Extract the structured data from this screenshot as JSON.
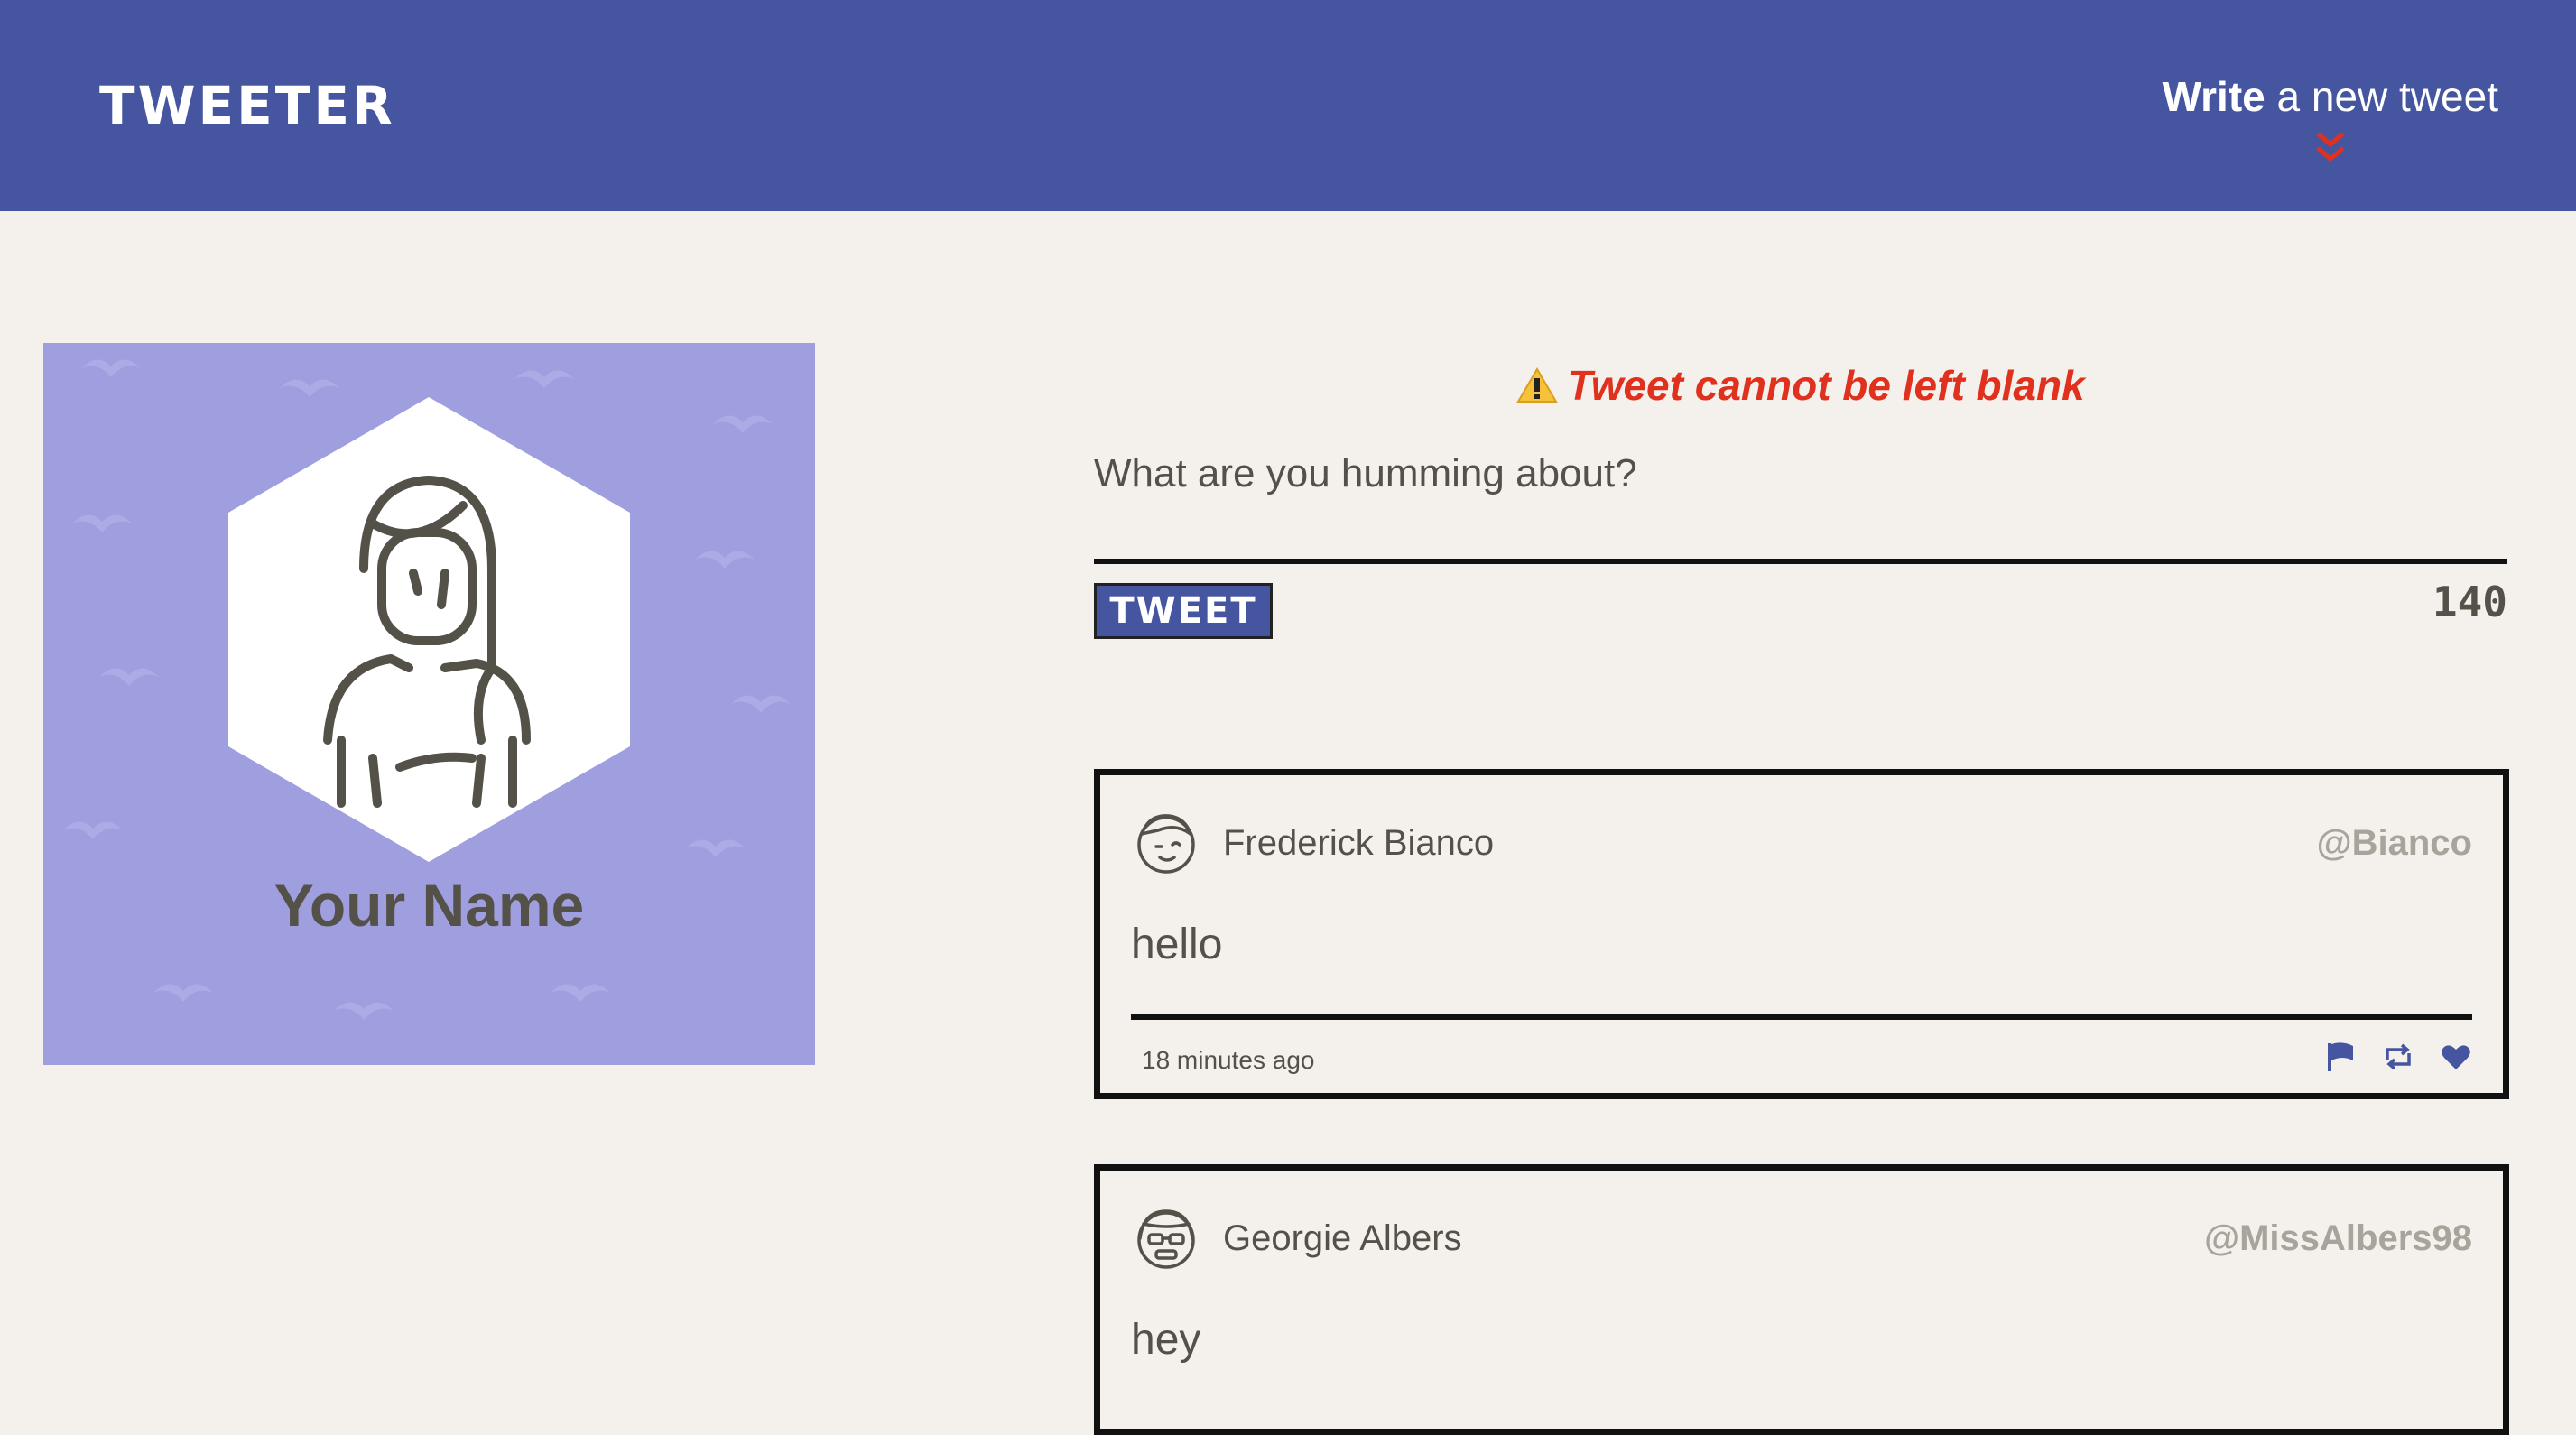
{
  "nav": {
    "brand": "TWEETER",
    "compose_bold": "Write",
    "compose_rest": " a new tweet",
    "accent": "#4655a0",
    "chevron_color": "#e0301e"
  },
  "profile": {
    "name": "Your Name",
    "card_color": "#9f9fe0"
  },
  "compose": {
    "error": "Tweet cannot be left blank",
    "error_icon": "warning-icon",
    "placeholder": "What are you humming about?",
    "value": "",
    "button_label": "TWEET",
    "counter": "140"
  },
  "tweets": [
    {
      "author": "Frederick Bianco",
      "handle": "@Bianco",
      "content": "hello",
      "time": "18 minutes ago",
      "actions": [
        "flag-icon",
        "retweet-icon",
        "heart-icon"
      ]
    },
    {
      "author": "Georgie Albers",
      "handle": "@MissAlbers98",
      "content": "hey"
    }
  ]
}
